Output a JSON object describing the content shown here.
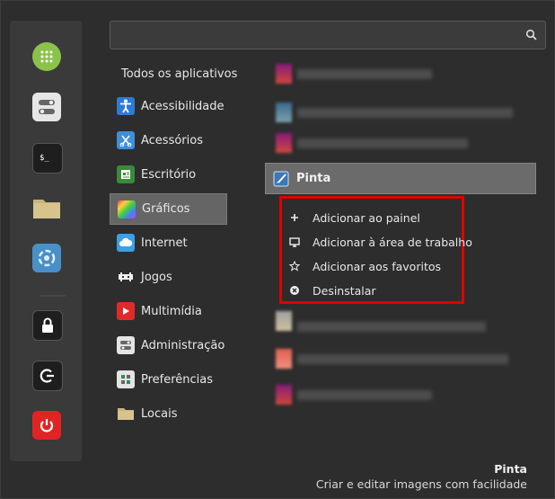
{
  "search": {
    "placeholder": "",
    "value": ""
  },
  "favorites": [
    {
      "name": "apps-grid-icon",
      "color": "#7fc04a"
    },
    {
      "name": "toggle-settings-icon",
      "color": "#d9d9d9"
    },
    {
      "name": "terminal-icon",
      "color": "#222222"
    },
    {
      "name": "folder-icon",
      "color": "#c9b37a"
    },
    {
      "name": "software-update-icon",
      "color": "#3f8fc8"
    },
    {
      "name": "lock-screen-icon",
      "color": "#222222"
    },
    {
      "name": "logout-icon",
      "color": "#222222"
    },
    {
      "name": "power-icon",
      "color": "#e02020"
    }
  ],
  "categories": {
    "all_label": "Todos os aplicativos",
    "items": [
      {
        "label": "Acessibilidade",
        "icon": "accessibility-icon",
        "selected": false
      },
      {
        "label": "Acessórios",
        "icon": "accessories-icon",
        "selected": false
      },
      {
        "label": "Escritório",
        "icon": "office-icon",
        "selected": false
      },
      {
        "label": "Gráficos",
        "icon": "graphics-icon",
        "selected": true
      },
      {
        "label": "Internet",
        "icon": "internet-icon",
        "selected": false
      },
      {
        "label": "Jogos",
        "icon": "games-icon",
        "selected": false
      },
      {
        "label": "Multimídia",
        "icon": "multimedia-icon",
        "selected": false
      },
      {
        "label": "Administração",
        "icon": "administration-icon",
        "selected": false
      },
      {
        "label": "Preferências",
        "icon": "preferences-icon",
        "selected": false
      },
      {
        "label": "Locais",
        "icon": "places-icon",
        "selected": false
      }
    ]
  },
  "apps": {
    "selected_label": "Pinta"
  },
  "context_menu": {
    "items": [
      {
        "label": "Adicionar ao painel",
        "icon": "plus-icon"
      },
      {
        "label": "Adicionar à área de trabalho",
        "icon": "desktop-icon"
      },
      {
        "label": "Adicionar aos favoritos",
        "icon": "star-icon"
      },
      {
        "label": "Desinstalar",
        "icon": "uninstall-icon"
      }
    ],
    "highlight_color": "#e00000"
  },
  "footer": {
    "app_name": "Pinta",
    "app_description": "Criar e editar imagens com facilidade"
  }
}
